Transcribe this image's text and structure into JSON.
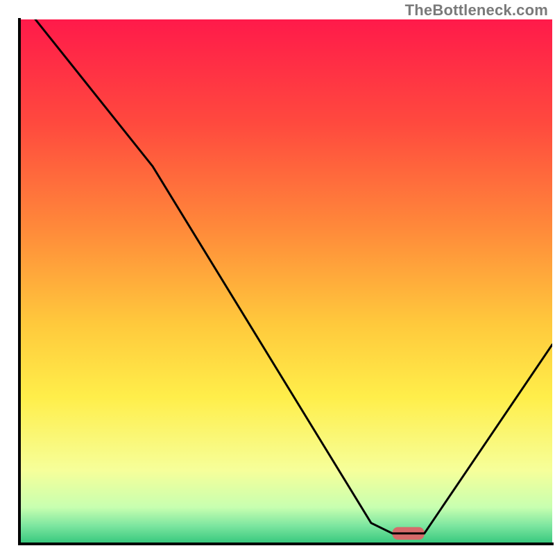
{
  "watermark": "TheBottleneck.com",
  "chart_data": {
    "type": "line",
    "title": "",
    "xlabel": "",
    "ylabel": "",
    "xlim": [
      0,
      100
    ],
    "ylim": [
      0,
      100
    ],
    "grid": false,
    "legend": false,
    "curve_points": [
      {
        "x": 3,
        "y": 100
      },
      {
        "x": 25,
        "y": 72
      },
      {
        "x": 66,
        "y": 4
      },
      {
        "x": 70,
        "y": 2
      },
      {
        "x": 76,
        "y": 2
      },
      {
        "x": 100,
        "y": 38
      }
    ],
    "marker": {
      "color": "#d66a6a",
      "x_start": 70,
      "x_end": 76,
      "y": 2,
      "thickness_pct": 2.4
    },
    "background_gradient": {
      "stops": [
        {
          "offset": 0.0,
          "color": "#ff1a4a"
        },
        {
          "offset": 0.2,
          "color": "#ff4a3e"
        },
        {
          "offset": 0.4,
          "color": "#ff8a3a"
        },
        {
          "offset": 0.58,
          "color": "#ffc93c"
        },
        {
          "offset": 0.72,
          "color": "#ffee4a"
        },
        {
          "offset": 0.86,
          "color": "#f6ff9a"
        },
        {
          "offset": 0.93,
          "color": "#c8ffb0"
        },
        {
          "offset": 0.965,
          "color": "#7de6a0"
        },
        {
          "offset": 1.0,
          "color": "#34c77c"
        }
      ]
    },
    "axes": {
      "color": "#000000",
      "thickness": 4
    }
  }
}
